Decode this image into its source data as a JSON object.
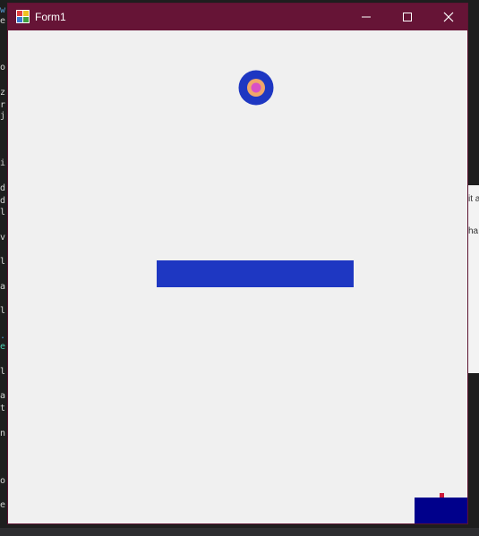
{
  "window": {
    "title": "Form1",
    "controls": {
      "minimize": "minimize",
      "maximize": "maximize",
      "close": "close"
    }
  },
  "game": {
    "ball_colors": {
      "outer": "#1e37c2",
      "ring": "#f0a66a",
      "core": "#d94fc6"
    },
    "paddle_color": "#1e37c2",
    "corner_block_color": "#00008b",
    "marker_color": "#cc1a3a"
  },
  "background": {
    "editor_fragments": [
      {
        "text": "w",
        "tone": "blue"
      },
      {
        "text": "e",
        "tone": "plain"
      },
      {
        "text": "o",
        "tone": "plain"
      },
      {
        "text": "z",
        "tone": "plain"
      },
      {
        "text": "r",
        "tone": "plain"
      },
      {
        "text": "j",
        "tone": "plain"
      },
      {
        "text": "i",
        "tone": "plain"
      },
      {
        "text": "d",
        "tone": "plain"
      },
      {
        "text": "d",
        "tone": "plain"
      },
      {
        "text": "l",
        "tone": "plain"
      },
      {
        "text": "v",
        "tone": "plain"
      },
      {
        "text": "l",
        "tone": "plain"
      },
      {
        "text": "a",
        "tone": "plain"
      },
      {
        "text": "l",
        "tone": "plain"
      },
      {
        "text": ".",
        "tone": "blue"
      },
      {
        "text": "e",
        "tone": "green"
      },
      {
        "text": "l",
        "tone": "plain"
      },
      {
        "text": "a",
        "tone": "plain"
      },
      {
        "text": "t",
        "tone": "plain"
      },
      {
        "text": "n",
        "tone": "plain"
      },
      {
        "text": "o",
        "tone": "plain"
      },
      {
        "text": "e",
        "tone": "plain"
      }
    ],
    "right_panel_fragments": [
      "it a",
      "ha"
    ]
  }
}
